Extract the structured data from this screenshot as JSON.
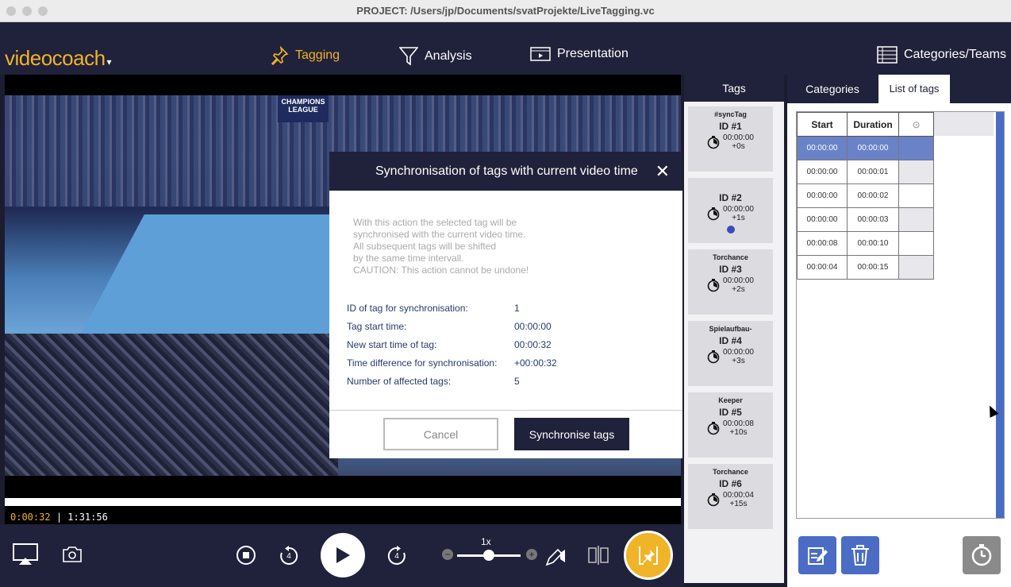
{
  "window": {
    "title": "PROJECT: /Users/jp/Documents/svatProjekte/LiveTagging.vc"
  },
  "app": {
    "logo": "videocoach"
  },
  "nav": {
    "tagging": "Tagging",
    "analysis": "Analysis",
    "presentation": "Presentation",
    "categories_teams": "Categories/Teams"
  },
  "video": {
    "overlay_logo": "CHAMPIONS LEAGUE",
    "current_time": "0:00:32",
    "total_time": "| 1:31:56"
  },
  "controls": {
    "speed": "1x",
    "rewind_seconds": "4",
    "forward_seconds": "4",
    "speed_fraction": 0.5
  },
  "tags_panel": {
    "title": "Tags",
    "cards": [
      {
        "category": "#syncTag",
        "id": "ID #1",
        "time": "00:00:00",
        "offset": "+0s"
      },
      {
        "category": "",
        "id": "ID #2",
        "time": "00:00:00",
        "offset": "+1s",
        "dot": true
      },
      {
        "category": "Torchance",
        "id": "ID #3",
        "time": "00:00:00",
        "offset": "+2s"
      },
      {
        "category": "Spielaufbau-",
        "id": "ID #4",
        "time": "00:00:00",
        "offset": "+3s"
      },
      {
        "category": "Keeper",
        "id": "ID #5",
        "time": "00:00:08",
        "offset": "+10s"
      },
      {
        "category": "Torchance",
        "id": "ID #6",
        "time": "00:00:04",
        "offset": "+15s"
      }
    ]
  },
  "right_panel": {
    "tabs": {
      "categories": "Categories",
      "list_of_tags": "List of tags"
    },
    "table": {
      "headers": {
        "start": "Start",
        "duration": "Duration",
        "extra": "⊙"
      },
      "rows": [
        {
          "start": "00:00:00",
          "duration": "00:00:00"
        },
        {
          "start": "00:00:00",
          "duration": "00:00:01"
        },
        {
          "start": "00:00:00",
          "duration": "00:00:02"
        },
        {
          "start": "00:00:00",
          "duration": "00:00:03"
        },
        {
          "start": "00:00:08",
          "duration": "00:00:10"
        },
        {
          "start": "00:00:04",
          "duration": "00:00:15"
        }
      ]
    }
  },
  "modal": {
    "title": "Synchronisation of tags with current video time",
    "warning": [
      "With this action the selected tag will be",
      "synchronised with the current video time.",
      "All subsequent tags will be shifted",
      "by the same time intervall.",
      "CAUTION: This action cannot be undone!"
    ],
    "fields": [
      {
        "label": "ID of tag for synchronisation:",
        "value": "1"
      },
      {
        "label": "Tag start time:",
        "value": "00:00:00"
      },
      {
        "label": "New start time of tag:",
        "value": "00:00:32"
      },
      {
        "label": "Time difference for synchronisation:",
        "value": "+00:00:32"
      },
      {
        "label": "Number of affected tags:",
        "value": "5"
      }
    ],
    "cancel_label": "Cancel",
    "confirm_label": "Synchronise tags"
  },
  "colors": {
    "navy": "#20213a",
    "accent": "#f0b429",
    "selection": "#6a82c7",
    "scrollbar": "#4a6cc4"
  }
}
